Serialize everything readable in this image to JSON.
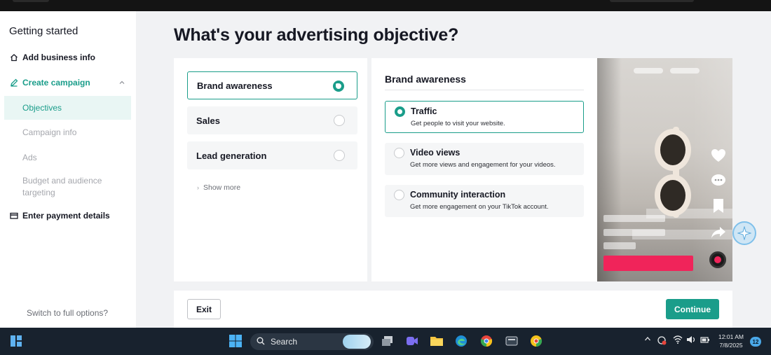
{
  "sidebar": {
    "title": "Getting started",
    "items": [
      {
        "label": "Add business info"
      },
      {
        "label": "Create campaign"
      },
      {
        "label": "Enter payment details"
      }
    ],
    "sub_items": [
      "Objectives",
      "Campaign info",
      "Ads",
      "Budget and audience targeting"
    ],
    "switch_label": "Switch to full options?"
  },
  "main": {
    "title": "What's your advertising objective?",
    "objectives": [
      "Brand awareness",
      "Sales",
      "Lead generation"
    ],
    "selected_objective": "Brand awareness",
    "show_more": "Show more",
    "detail": {
      "title": "Brand awareness",
      "options": [
        {
          "title": "Traffic",
          "desc": "Get people to visit your website."
        },
        {
          "title": "Video views",
          "desc": "Get more views and engagement for your videos."
        },
        {
          "title": "Community interaction",
          "desc": "Get more engagement on your TikTok account."
        }
      ],
      "selected": "Traffic"
    }
  },
  "footer": {
    "exit_label": "Exit",
    "continue_label": "Continue"
  },
  "taskbar": {
    "search_label": "Search",
    "time": "12:01 AM",
    "date": "7/8/2025",
    "notification_count": "12"
  },
  "colors": {
    "accent": "#1a9d8a",
    "tiktok_red": "#f0245a",
    "taskbar": "#18222e"
  },
  "icons": [
    "home-icon",
    "edit-icon",
    "chevron-up-icon",
    "card-icon",
    "heart-icon",
    "comment-icon",
    "bookmark-icon",
    "share-icon",
    "sparkle-icon",
    "windows-start-icon",
    "search-icon"
  ]
}
